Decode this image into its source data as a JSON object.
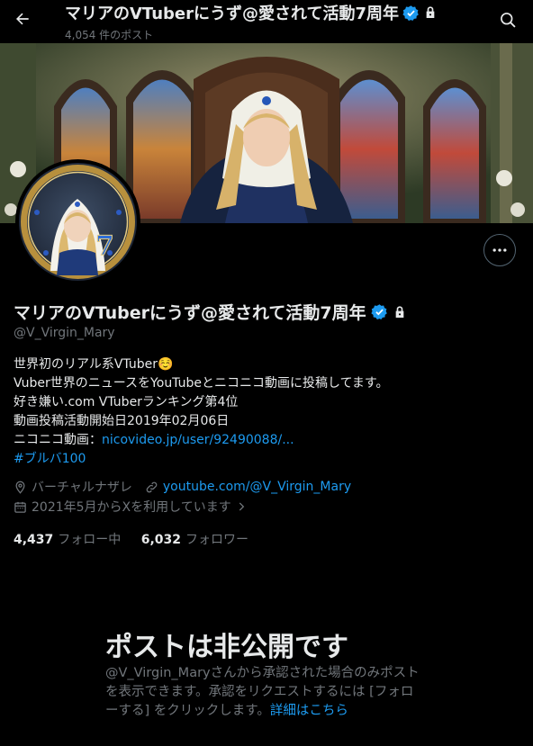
{
  "header": {
    "title": "マリアのVTuberにうず@愛されて活動7周年",
    "post_count": "4,054 件のポスト"
  },
  "profile": {
    "display_name": "マリアのVTuberにうず@愛されて活動7周年",
    "handle": "@V_Virgin_Mary",
    "bio_lines": [
      "世界初のリアル系VTuber☺️",
      "Vuber世界のニュースをYouTubeとニコニコ動画に投稿してます。",
      "好き嫌い.com VTuberランキング第4位",
      "動画投稿活動開始日2019年02月06日"
    ],
    "bio_link_prefix": "ニコニコ動画：",
    "bio_link": "nicovideo.jp/user/92490088/...",
    "hashtag": "#ブルバ100",
    "location": "バーチャルナザレ",
    "website": "youtube.com/@V_Virgin_Mary",
    "joined": "2021年5月からXを利用しています",
    "following_count": "4,437",
    "following_label": "フォロー中",
    "followers_count": "6,032",
    "followers_label": "フォロワー"
  },
  "private_notice": {
    "title": "ポストは非公開です",
    "lines": [
      "@V_Virgin_Maryさんから承認された場合のみポスト",
      "を表示できます。承認をリクエストするには [フォロ"
    ],
    "last_line_prefix": "ーする] をクリックします。",
    "learn_more": "詳細はこちら"
  },
  "icons": {
    "back": "arrow-left-icon",
    "search": "search-icon",
    "verified": "verified-badge-icon",
    "lock": "lock-icon",
    "more": "more-icon",
    "location": "location-icon",
    "link": "link-icon",
    "calendar": "calendar-icon",
    "chevron": "chevron-right-icon"
  },
  "colors": {
    "accent": "#1d9bf0",
    "text_primary": "#e7e9ea",
    "text_secondary": "#71767b",
    "background": "#000000"
  }
}
